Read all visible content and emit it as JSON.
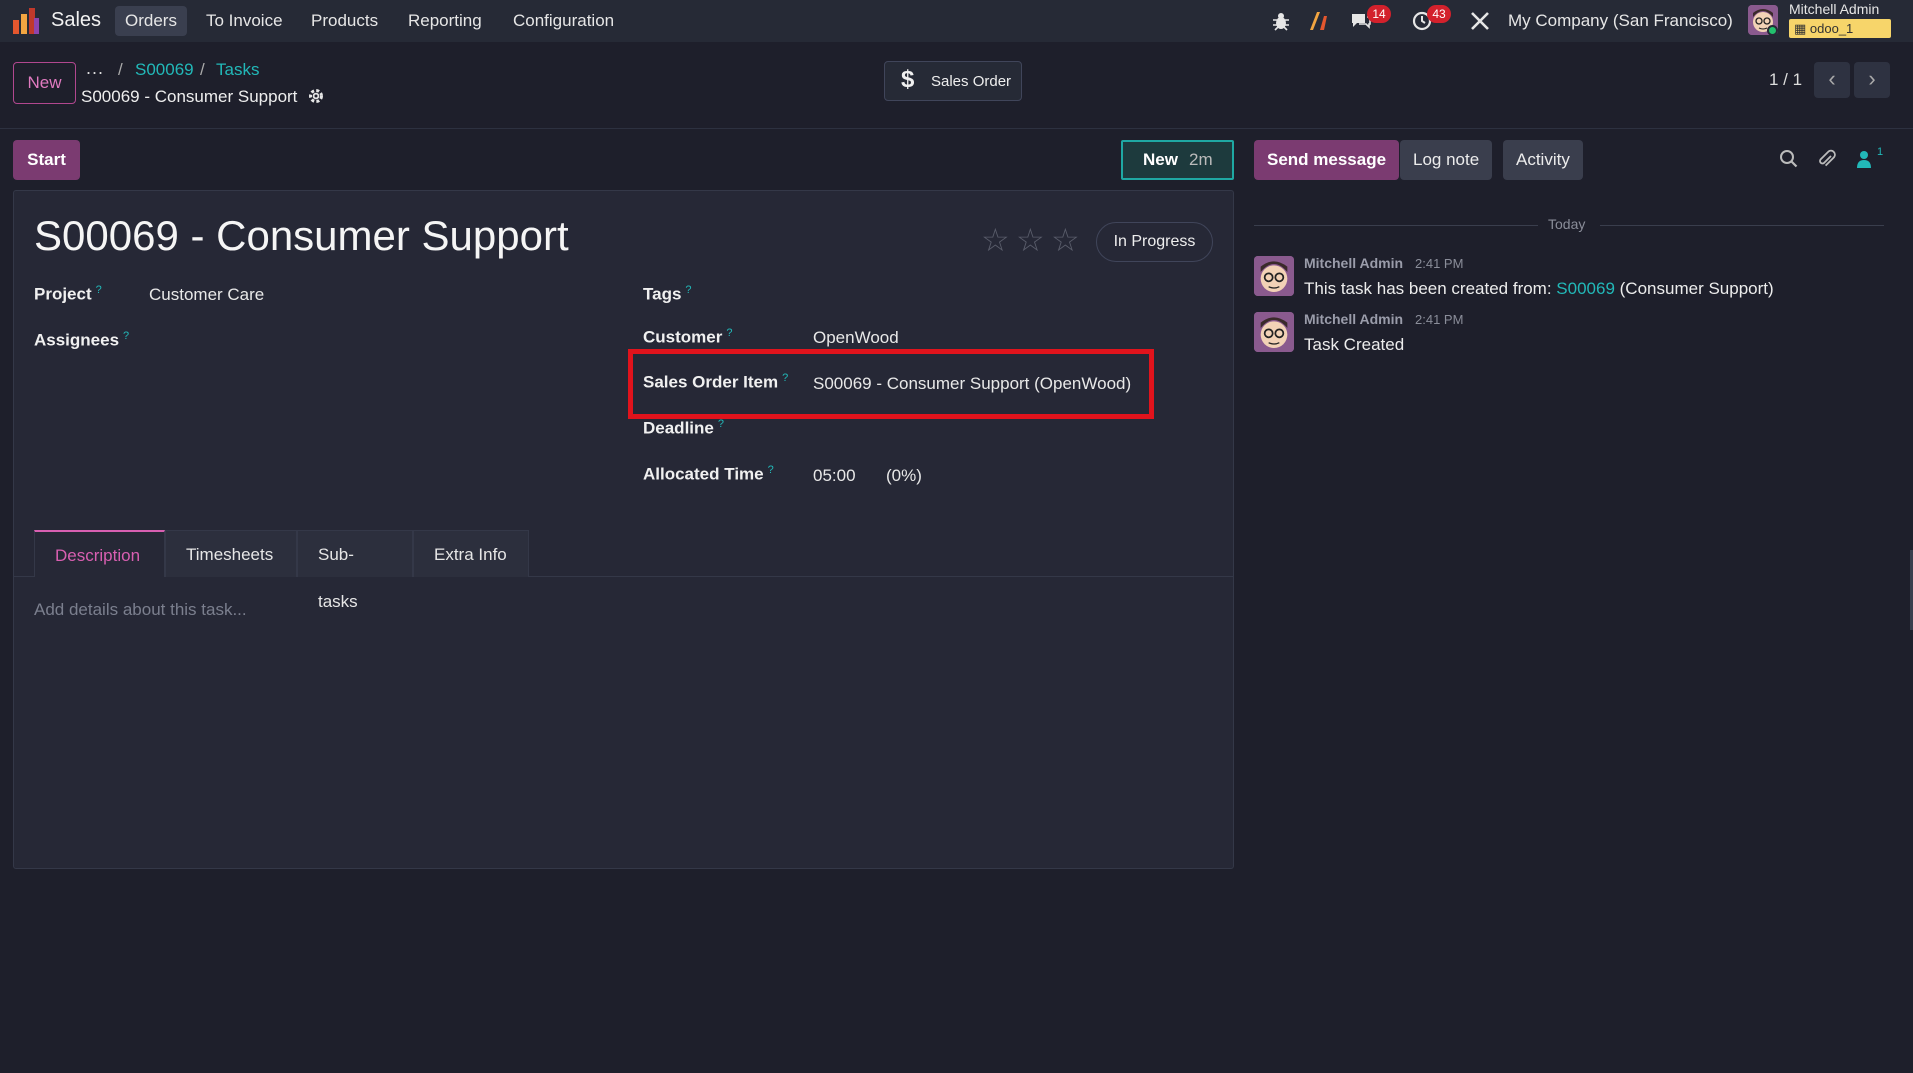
{
  "navbar": {
    "app_name": "Sales",
    "menu": [
      {
        "label": "Orders",
        "active": true
      },
      {
        "label": "To Invoice"
      },
      {
        "label": "Products"
      },
      {
        "label": "Reporting"
      },
      {
        "label": "Configuration"
      }
    ],
    "messages_badge": "14",
    "activities_badge": "43",
    "company": "My Company (San Francisco)",
    "user_name": "Mitchell Admin",
    "database": "odoo_1"
  },
  "control_panel": {
    "new_button": "New",
    "breadcrumb_more": "...",
    "breadcrumbs": [
      "S00069",
      "Tasks"
    ],
    "record_title": "S00069 - Consumer Support",
    "smart_button": "Sales Order",
    "pager": "1 / 1"
  },
  "statusbar": {
    "start_button": "Start",
    "stage_name": "New",
    "stage_time": "2m"
  },
  "form": {
    "title": "S00069 - Consumer Support",
    "priority_stars": 0,
    "state": "In Progress",
    "fields": {
      "project": {
        "label": "Project",
        "value": "Customer Care"
      },
      "assignees": {
        "label": "Assignees",
        "value": ""
      },
      "tags": {
        "label": "Tags",
        "value": ""
      },
      "customer": {
        "label": "Customer",
        "value": "OpenWood"
      },
      "sales_order_item": {
        "label": "Sales Order Item",
        "value": "S00069 - Consumer Support (OpenWood)"
      },
      "deadline": {
        "label": "Deadline",
        "value": ""
      },
      "allocated_time": {
        "label": "Allocated Time",
        "value": "05:00",
        "percent": "(0%)"
      }
    },
    "help_mark": "?",
    "tabs": [
      {
        "label": "Description",
        "active": true
      },
      {
        "label": "Timesheets"
      },
      {
        "label": "Sub-tasks"
      },
      {
        "label": "Extra Info"
      }
    ],
    "description_placeholder": "Add details about this task..."
  },
  "chatter": {
    "send_message": "Send message",
    "log_note": "Log note",
    "activity": "Activity",
    "followers_count": "1",
    "date_separator": "Today",
    "messages": [
      {
        "author": "Mitchell Admin",
        "time": "2:41 PM",
        "body_prefix": "This task has been created from: ",
        "body_link": "S00069",
        "body_suffix": " (Consumer Support)"
      },
      {
        "author": "Mitchell Admin",
        "time": "2:41 PM",
        "body": "Task Created"
      }
    ]
  },
  "colors": {
    "background": "#1e1f2b",
    "accent_purple": "#7b3b71",
    "link_teal": "#22b8b8",
    "highlight_red": "#e1131c"
  }
}
